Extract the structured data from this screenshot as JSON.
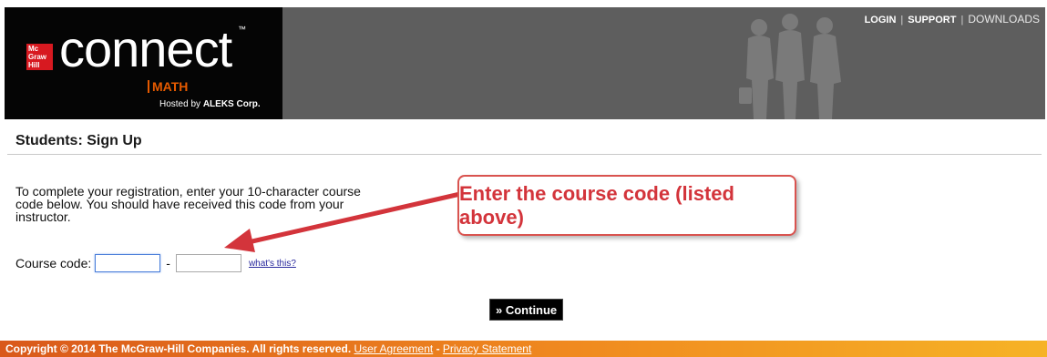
{
  "header": {
    "brand_mh_lines": [
      "Mc",
      "Graw",
      "Hill"
    ],
    "connect": "connect",
    "tm": "™",
    "product": "MATH",
    "hosted_prefix": "Hosted by ",
    "hosted_company": "ALEKS Corp.",
    "nav": {
      "login": "LOGIN",
      "support": "SUPPORT",
      "downloads": "DOWNLOADS",
      "separator": "|"
    },
    "colors": {
      "bar": "#5e5e5e",
      "logo_bg": "#050505",
      "accent": "#e55a00",
      "mh_red": "#d71920"
    }
  },
  "page": {
    "title": "Students: Sign Up",
    "instructions": "To complete your registration, enter your 10-character course code below. You should have received this code from your instructor.",
    "course_code_label": "Course code:",
    "code_part1": "",
    "code_part2": "",
    "dash": "-",
    "whats_this": "what's this?",
    "continue_label": "» Continue"
  },
  "annotation": {
    "callout_text": "Enter the course code (listed above)",
    "color": "#d3343b"
  },
  "footer": {
    "copyright": "Copyright © 2014 The McGraw-Hill Companies. All rights reserved.",
    "user_agreement": "User Agreement",
    "separator": " - ",
    "privacy": "Privacy Statement"
  }
}
